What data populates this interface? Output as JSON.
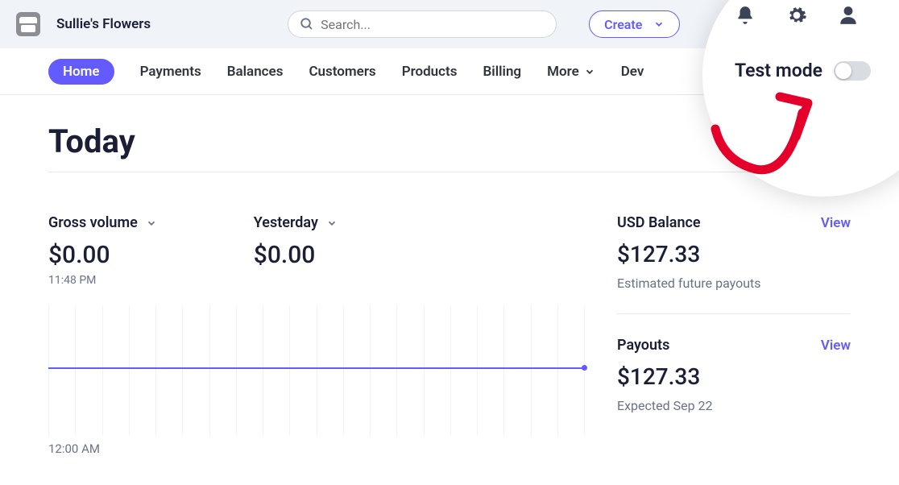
{
  "header": {
    "store_name": "Sullie's Flowers",
    "search_placeholder": "Search...",
    "create_label": "Create"
  },
  "nav": {
    "items": [
      "Home",
      "Payments",
      "Balances",
      "Customers",
      "Products",
      "Billing",
      "More",
      "Dev"
    ],
    "active_index": 0
  },
  "test_mode": {
    "label": "Test mode",
    "enabled": false
  },
  "page": {
    "title": "Today"
  },
  "metrics": {
    "gross_label": "Gross volume",
    "gross_value": "$0.00",
    "gross_time": "11:48 PM",
    "yesterday_label": "Yesterday",
    "yesterday_value": "$0.00"
  },
  "chart_data": {
    "type": "line",
    "title": "Gross volume",
    "xlabel": "",
    "ylabel": "",
    "x_start": "12:00 AM",
    "x_current": "11:48 PM",
    "ylim": [
      0,
      0
    ],
    "series": [
      {
        "name": "Today",
        "value_constant": 0
      },
      {
        "name": "Yesterday",
        "value_constant": 0
      }
    ],
    "grid_columns": 20
  },
  "chart": {
    "x_start": "12:00 AM"
  },
  "balance": {
    "usd_title": "USD Balance",
    "usd_value": "$127.33",
    "usd_caption": "Estimated future payouts",
    "view_label": "View",
    "payouts_title": "Payouts",
    "payouts_value": "$127.33",
    "payouts_caption": "Expected Sep 22"
  }
}
